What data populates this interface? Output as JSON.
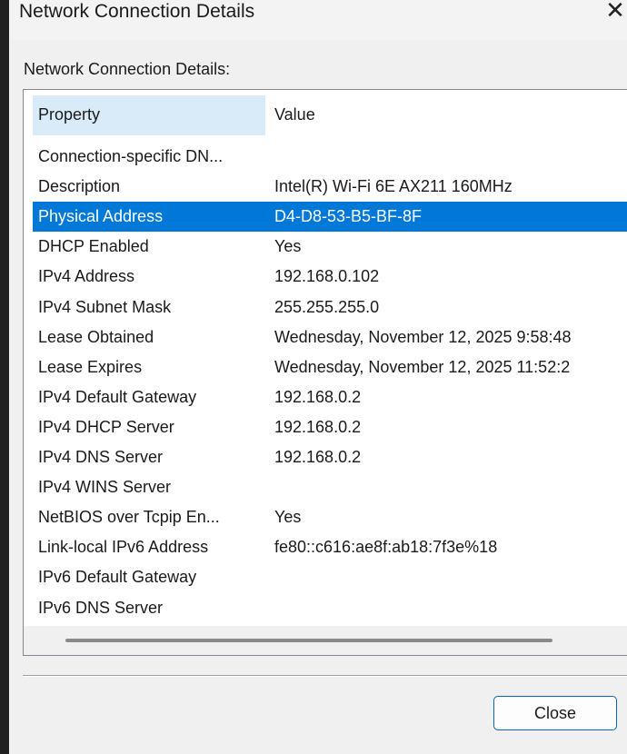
{
  "window": {
    "title": "Network Connection Details",
    "close_glyph": "✕"
  },
  "group_label": "Network Connection Details:",
  "table": {
    "columns": [
      "Property",
      "Value"
    ],
    "selected_index": 2,
    "rows": [
      {
        "property": "Connection-specific DN...",
        "value": ""
      },
      {
        "property": "Description",
        "value": "Intel(R) Wi-Fi 6E AX211 160MHz"
      },
      {
        "property": "Physical Address",
        "value": "D4-D8-53-B5-BF-8F"
      },
      {
        "property": "DHCP Enabled",
        "value": "Yes"
      },
      {
        "property": "IPv4 Address",
        "value": "192.168.0.102"
      },
      {
        "property": "IPv4 Subnet Mask",
        "value": "255.255.255.0"
      },
      {
        "property": "Lease Obtained",
        "value": "Wednesday, November 12, 2025 9:58:48"
      },
      {
        "property": "Lease Expires",
        "value": "Wednesday, November 12, 2025 11:52:2"
      },
      {
        "property": "IPv4 Default Gateway",
        "value": "192.168.0.2"
      },
      {
        "property": "IPv4 DHCP Server",
        "value": "192.168.0.2"
      },
      {
        "property": "IPv4 DNS Server",
        "value": "192.168.0.2"
      },
      {
        "property": "IPv4 WINS Server",
        "value": ""
      },
      {
        "property": "NetBIOS over Tcpip En...",
        "value": "Yes"
      },
      {
        "property": "Link-local IPv6 Address",
        "value": "fe80::c616:ae8f:ab18:7f3e%18"
      },
      {
        "property": "IPv6 Default Gateway",
        "value": ""
      },
      {
        "property": "IPv6 DNS Server",
        "value": ""
      }
    ]
  },
  "buttons": {
    "close_label": "Close"
  },
  "colors": {
    "selection": "#0078d7",
    "header_highlight": "#d9ebf9",
    "button_border": "#0067c0"
  }
}
